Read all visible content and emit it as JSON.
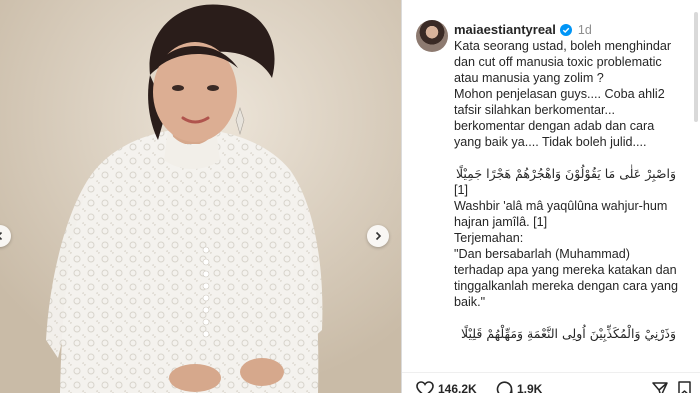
{
  "post": {
    "username": "maiaestiantyreal",
    "time": "1d",
    "caption_lines": [
      "Kata seorang ustad, boleh menghindar",
      "dan cut off manusia toxic problematic",
      "atau manusia yang zolim ?",
      "Mohon penjelasan guys.... Coba ahli2",
      "tafsir silahkan berkomentar...",
      "berkomentar dengan adab dan cara",
      "yang baik ya.... Tidak boleh julid...."
    ],
    "arabic_1": "وَاصْبِرْ عَلٰى مَا يَقُوْلُوْنَ وَاهْجُرْهُمْ هَجْرًا جَمِيْلًا",
    "ref_1": "[1]",
    "translit_lines": [
      "Washbir 'alâ mâ yaqûlûna wahjur-hum",
      "hajran jamîlâ. [1]"
    ],
    "terjemahan_label": "Terjemahan:",
    "translation_lines": [
      "\"Dan bersabarlah (Muhammad)",
      "terhadap apa yang mereka katakan dan",
      "tinggalkanlah mereka dengan cara yang",
      "baik.\""
    ],
    "arabic_2": "وَذَرْنِيْ وَالْمُكَذِّبِيْنَ اُولِى النَّعْمَةِ وَمَهِّلْهُمْ قَلِيْلًا"
  },
  "actions": {
    "likes": "146,2K",
    "comments": "1,9K"
  },
  "icons": {
    "verified": "verified-badge-icon",
    "prev": "chevron-left-icon",
    "next": "chevron-right-icon",
    "like": "heart-icon",
    "comment": "comment-icon",
    "share": "send-icon",
    "save": "bookmark-icon"
  },
  "colors": {
    "verified_blue": "#0095f6",
    "muted": "#8e8e8e"
  }
}
